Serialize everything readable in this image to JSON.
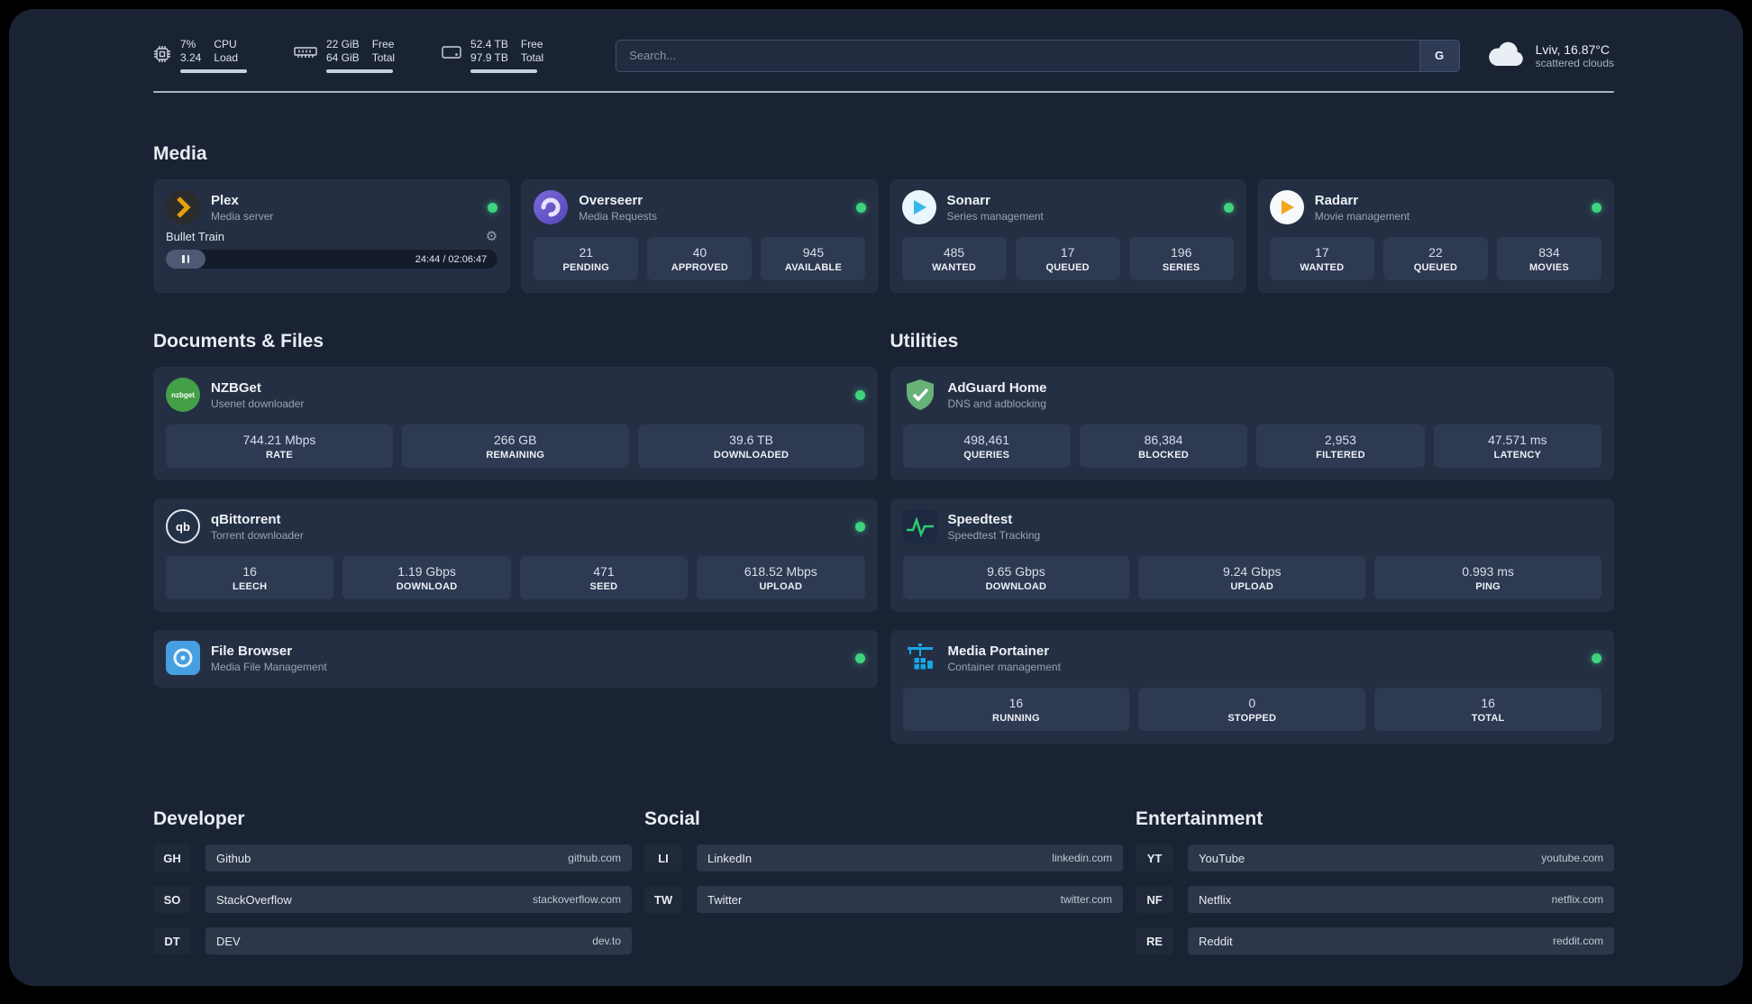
{
  "colors": {
    "background": "#1a2334",
    "card": "#252f44",
    "stat_box": "#2e3952",
    "status_green": "#3ed37f",
    "plex_amber": "#e5a00d",
    "radarr_amber": "#f5a623",
    "sonarr_blue": "#35b8ea",
    "adguard_green": "#67b279",
    "speedtest_green": "#2ecc71",
    "portainer_blue": "#18a6e0"
  },
  "icons": {
    "gear": "⚙"
  },
  "topbar": {
    "cpu": {
      "value1": "7%",
      "value2": "3.24",
      "label1": "CPU",
      "label2": "Load"
    },
    "ram": {
      "value1": "22 GiB",
      "value2": "64 GiB",
      "label1": "Free",
      "label2": "Total"
    },
    "disk": {
      "value1": "52.4 TB",
      "value2": "97.9 TB",
      "label1": "Free",
      "label2": "Total"
    },
    "search": {
      "placeholder": "Search...",
      "engine_label": "G"
    },
    "weather": {
      "location": "Lviv, 16.87°C",
      "condition": "scattered clouds"
    }
  },
  "sections": {
    "media": "Media",
    "documents": "Documents & Files",
    "utilities": "Utilities",
    "developer": "Developer",
    "social": "Social",
    "entertainment": "Entertainment"
  },
  "services": {
    "plex": {
      "title": "Plex",
      "subtitle": "Media server",
      "now_playing": "Bullet Train",
      "time": "24:44 / 02:06:47",
      "progress_percent": 12
    },
    "overseerr": {
      "title": "Overseerr",
      "subtitle": "Media Requests",
      "stats": [
        {
          "value": "21",
          "label": "PENDING"
        },
        {
          "value": "40",
          "label": "APPROVED"
        },
        {
          "value": "945",
          "label": "AVAILABLE"
        }
      ]
    },
    "sonarr": {
      "title": "Sonarr",
      "subtitle": "Series management",
      "stats": [
        {
          "value": "485",
          "label": "WANTED"
        },
        {
          "value": "17",
          "label": "QUEUED"
        },
        {
          "value": "196",
          "label": "SERIES"
        }
      ]
    },
    "radarr": {
      "title": "Radarr",
      "subtitle": "Movie management",
      "stats": [
        {
          "value": "17",
          "label": "WANTED"
        },
        {
          "value": "22",
          "label": "QUEUED"
        },
        {
          "value": "834",
          "label": "MOVIES"
        }
      ]
    },
    "nzbget": {
      "title": "NZBGet",
      "subtitle": "Usenet downloader",
      "icon_text": "nzbget",
      "stats": [
        {
          "value": "744.21 Mbps",
          "label": "RATE"
        },
        {
          "value": "266 GB",
          "label": "REMAINING"
        },
        {
          "value": "39.6 TB",
          "label": "DOWNLOADED"
        }
      ]
    },
    "qbittorrent": {
      "title": "qBittorrent",
      "subtitle": "Torrent downloader",
      "icon_text": "qb",
      "stats": [
        {
          "value": "16",
          "label": "LEECH"
        },
        {
          "value": "1.19 Gbps",
          "label": "DOWNLOAD"
        },
        {
          "value": "471",
          "label": "SEED"
        },
        {
          "value": "618.52 Mbps",
          "label": "UPLOAD"
        }
      ]
    },
    "filebrowser": {
      "title": "File Browser",
      "subtitle": "Media File Management"
    },
    "adguard": {
      "title": "AdGuard Home",
      "subtitle": "DNS and adblocking",
      "stats": [
        {
          "value": "498,461",
          "label": "QUERIES"
        },
        {
          "value": "86,384",
          "label": "BLOCKED"
        },
        {
          "value": "2,953",
          "label": "FILTERED"
        },
        {
          "value": "47.571 ms",
          "label": "LATENCY"
        }
      ]
    },
    "speedtest": {
      "title": "Speedtest",
      "subtitle": "Speedtest Tracking",
      "stats": [
        {
          "value": "9.65 Gbps",
          "label": "DOWNLOAD"
        },
        {
          "value": "9.24 Gbps",
          "label": "UPLOAD"
        },
        {
          "value": "0.993 ms",
          "label": "PING"
        }
      ]
    },
    "portainer": {
      "title": "Media Portainer",
      "subtitle": "Container management",
      "stats": [
        {
          "value": "16",
          "label": "RUNNING"
        },
        {
          "value": "0",
          "label": "STOPPED"
        },
        {
          "value": "16",
          "label": "TOTAL"
        }
      ]
    }
  },
  "bookmarks": {
    "developer": [
      {
        "abbr": "GH",
        "name": "Github",
        "url": "github.com"
      },
      {
        "abbr": "SO",
        "name": "StackOverflow",
        "url": "stackoverflow.com"
      },
      {
        "abbr": "DT",
        "name": "DEV",
        "url": "dev.to"
      }
    ],
    "social": [
      {
        "abbr": "LI",
        "name": "LinkedIn",
        "url": "linkedin.com"
      },
      {
        "abbr": "TW",
        "name": "Twitter",
        "url": "twitter.com"
      }
    ],
    "entertainment": [
      {
        "abbr": "YT",
        "name": "YouTube",
        "url": "youtube.com"
      },
      {
        "abbr": "NF",
        "name": "Netflix",
        "url": "netflix.com"
      },
      {
        "abbr": "RE",
        "name": "Reddit",
        "url": "reddit.com"
      }
    ]
  }
}
